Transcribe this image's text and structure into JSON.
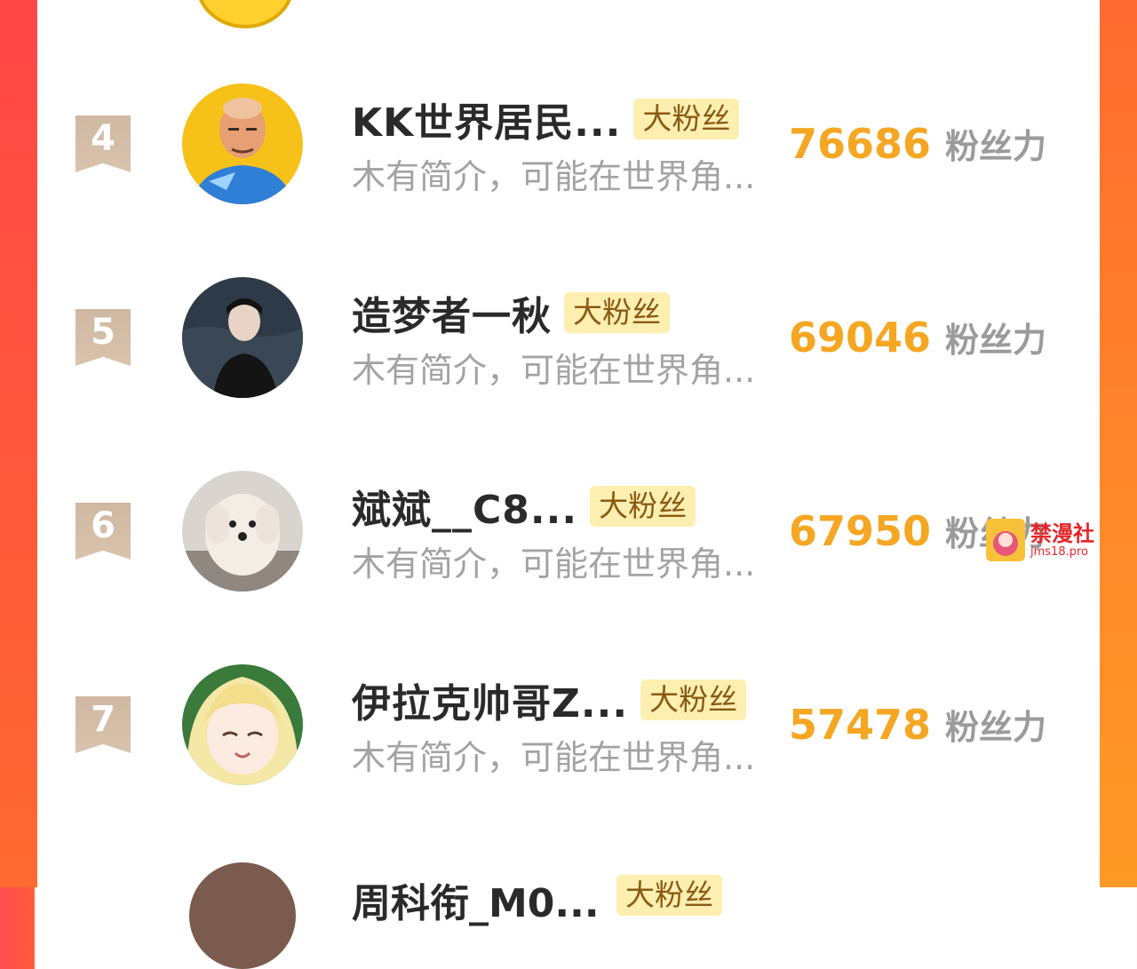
{
  "badge_label": "大粉丝",
  "score_unit": "粉丝力",
  "rows": [
    {
      "rank": "4",
      "name": "KK世界居民...",
      "intro": "木有简介，可能在世界角...",
      "score": "76686",
      "avatar": "bald-man-cartoon"
    },
    {
      "rank": "5",
      "name": "造梦者一秋",
      "intro": "木有简介，可能在世界角...",
      "score": "69046",
      "avatar": "man-black-coat"
    },
    {
      "rank": "6",
      "name": "斌斌__C8...",
      "intro": "木有简介，可能在世界角...",
      "score": "67950",
      "avatar": "white-dog"
    },
    {
      "rank": "7",
      "name": "伊拉克帅哥Z...",
      "intro": "木有简介，可能在世界角...",
      "score": "57478",
      "avatar": "anime-girl-blonde"
    }
  ],
  "bottom_row": {
    "name": "周科衔_M0...",
    "badge": "大粉丝"
  },
  "watermark": {
    "title": "禁漫社",
    "url": "jms18.pro"
  },
  "colors": {
    "score": "#f5a623",
    "badge_bg": "#fdefb0",
    "rank_flag": "#d3bca6",
    "side_gradient_left": "#ff4747",
    "side_gradient_right": "#ff9a26"
  }
}
